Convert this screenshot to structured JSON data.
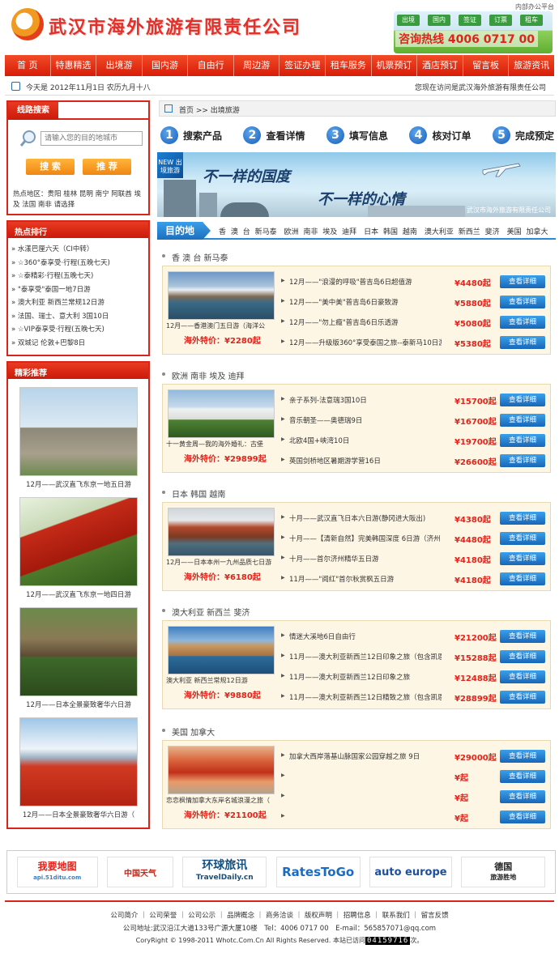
{
  "header": {
    "site_name": "武汉市海外旅游有限责任公司",
    "top_link": "内部办公平台",
    "tags": [
      "出境",
      "国内",
      "签证",
      "订票",
      "租车"
    ],
    "hotline_label": "咨询热线",
    "hotline_number": "4006 0717 00"
  },
  "nav": [
    "首 页",
    "特惠精选",
    "出境游",
    "国内游",
    "自由行",
    "周边游",
    "签证办理",
    "租车服务",
    "机票预订",
    "酒店预订",
    "留言板",
    "旅游资讯"
  ],
  "datebar": {
    "date": "今天是 2012年11月1日 农历九月十八",
    "welcome": "您现在访问是武汉海外旅游有限责任公司"
  },
  "search": {
    "tab": "线路搜索",
    "placeholder": "请输入您的目的地城市",
    "search_btn": "搜 索",
    "recommend_btn": "推 荐",
    "hot_area": "热点地区：贵阳 桂林 昆明 南宁 阿联酋 埃及 法国 南非 请选择"
  },
  "ranking": {
    "title": "热点排行",
    "items": [
      "水漾巴厘六天（CI中转）",
      "☆360°泰享受·行程(五晚七天)",
      "☆泰精彩·行程(五晚七天)",
      "\"泰享受\"泰国一地7日游",
      "澳大利亚 新西兰常规12日游",
      "法国、瑞士、意大利 3国10日",
      "☆VIP泰享受·行程(五晚七天)",
      "双城记 伦敦+巴黎8日"
    ]
  },
  "recommend": {
    "title": "精彩推荐",
    "items": [
      "12月——武汉直飞东京一地五日游",
      "12月——武汉直飞东京一地四日游",
      "12月——日本全景豪致奢华六日游",
      "12月——日本全景豪致奢华六日游（"
    ]
  },
  "breadcrumb": "首页 >> 出境旅游",
  "steps": [
    {
      "num": "1",
      "label": "搜索产品"
    },
    {
      "num": "2",
      "label": "查看详情"
    },
    {
      "num": "3",
      "label": "填写信息"
    },
    {
      "num": "4",
      "label": "核对订单"
    },
    {
      "num": "5",
      "label": "完成预定"
    }
  ],
  "banner": {
    "badge": "NEW 出境旅游",
    "line1": "不一样的国度",
    "line2": "不一样的心情",
    "company": "武汉市海外旅游有限责任公司"
  },
  "destinations": {
    "tab": "目的地",
    "links": "香 澳 台 新马泰　欧洲 南非 埃及 迪拜　日本 韩国 越南　澳大利亚 新西兰 斐济　美国 加拿大"
  },
  "detail_label": "查看详细",
  "sections": [
    {
      "title": "香 澳 台 新马泰",
      "caption": "12月——香港澳门五日游（海洋公",
      "price_label": "海外特价：",
      "price": "¥2280起",
      "rows": [
        {
          "title": "12月——\"浪漫的呼吸\"普吉岛6日超值游",
          "price": "¥4480起"
        },
        {
          "title": "12月——\"美中美\"普吉岛6日豪致游",
          "price": "¥5880起"
        },
        {
          "title": "12月——\"勿上瘾\"普吉岛6日乐透游",
          "price": "¥5080起"
        },
        {
          "title": "12月——升级版360°享受泰国之旅--泰新马10日游",
          "price": "¥5380起"
        }
      ]
    },
    {
      "title": "欧洲 南非 埃及 迪拜",
      "caption": "十一黄金周—我的海外婚礼：古堡",
      "price_label": "海外特价：",
      "price": "¥29899起",
      "rows": [
        {
          "title": "亲子系列-法意瑞3国10日",
          "price": "¥15700起"
        },
        {
          "title": "音乐朝圣——奥德瑞9日",
          "price": "¥16700起"
        },
        {
          "title": "北欧4国+峡湾10日",
          "price": "¥19700起"
        },
        {
          "title": "英国剑桥地区暑期游学营16日",
          "price": "¥26600起"
        }
      ]
    },
    {
      "title": "日本 韩国 越南",
      "caption": "12月——日本本州一九州品质七日游",
      "price_label": "海外特价：",
      "price": "¥6180起",
      "rows": [
        {
          "title": "十月——武汉直飞日本六日游(静冈进大阪出)",
          "price": "¥4380起"
        },
        {
          "title": "十月——【清新自然】完美韩国深度 6日游（济州",
          "price": "¥4480起"
        },
        {
          "title": "十月——首尔济州精华五日游",
          "price": "¥4180起"
        },
        {
          "title": "11月——\"阅红\"首尔秋赏枫五日游",
          "price": "¥4180起"
        }
      ]
    },
    {
      "title": "澳大利亚 新西兰 斐济",
      "caption": "澳大利亚 新西兰常规12日游",
      "price_label": "海外特价：",
      "price": "¥9880起",
      "rows": [
        {
          "title": "情迷大溪地6日自由行",
          "price": "¥21200起"
        },
        {
          "title": "11月——澳大利亚新西兰12日印象之旅（包含凯恩",
          "price": "¥15288起"
        },
        {
          "title": "11月——澳大利亚新西兰12日印象之旅",
          "price": "¥12488起"
        },
        {
          "title": "11月——澳大利亚新西兰12日精致之旅（包含凯恩",
          "price": "¥28899起"
        }
      ]
    },
    {
      "title": "美国 加拿大",
      "caption": "恋恋枫情加拿大东岸名城浪漫之旅（",
      "price_label": "海外特价：",
      "price": "¥21100起",
      "rows": [
        {
          "title": "加拿大西岸落基山脉国家公园穿越之旅 9日",
          "price": "¥29000起"
        },
        {
          "title": "",
          "price": "¥起"
        },
        {
          "title": "",
          "price": "¥起"
        },
        {
          "title": "",
          "price": "¥起"
        }
      ]
    }
  ],
  "partner_logos": [
    "我要地图",
    "api.51ditu.com",
    "中国天气",
    "环球旅讯",
    "TravelDaily.cn",
    "RatesToGo",
    "auto europe",
    "德国",
    "旅游胜地"
  ],
  "footer": {
    "links": "公司简介 ｜ 公司荣誉 ｜ 公司公示 ｜ 品牌概念 ｜ 商务洽谈 ｜ 版权声明 ｜ 招聘信息 ｜ 联系我们 ｜ 留言反馈",
    "address": "公司地址:武汉沿江大道133号广源大厦10楼　Tel：4006 0717 00　E-mail：565857071@qq.com",
    "copyright": "CoryRight © 1998-2011 Whotc.Com.Cn All Rights Reserved. 本站已访问",
    "counter": "04159716",
    "suffix": "次。"
  },
  "colors": {
    "brand_red": "#d9241b",
    "nav_red": "#e4361c",
    "accent_blue": "#1c6fbf",
    "price_red": "#e2231a",
    "btn_orange": "#f08612"
  }
}
